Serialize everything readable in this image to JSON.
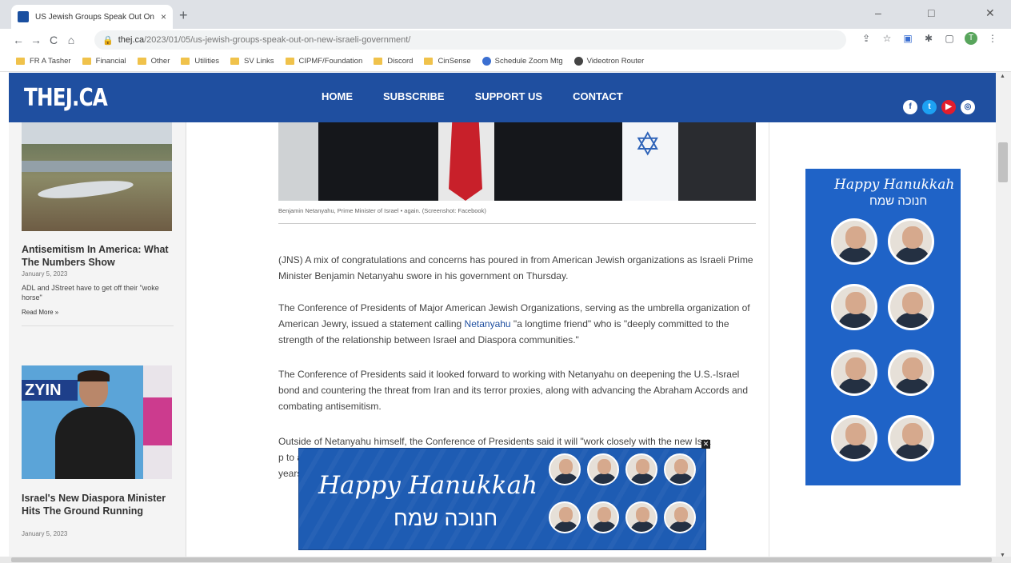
{
  "browser": {
    "tab_title": "US Jewish Groups Speak Out On",
    "tab_close": "×",
    "new_tab": "+",
    "url_host": "thej.ca",
    "url_path": "/2023/01/05/us-jewish-groups-speak-out-on-new-israeli-government/",
    "window_controls": [
      "–",
      "□",
      "✕"
    ],
    "nav": [
      "←",
      "→",
      "C",
      "⌂"
    ],
    "profile_initial": "T"
  },
  "bookmarks": [
    {
      "label": "FR A Tasher",
      "icon": "folder"
    },
    {
      "label": "Financial",
      "icon": "folder"
    },
    {
      "label": "Other",
      "icon": "folder"
    },
    {
      "label": "Utilities",
      "icon": "folder"
    },
    {
      "label": "SV Links",
      "icon": "folder"
    },
    {
      "label": "CIPMF/Foundation",
      "icon": "folder"
    },
    {
      "label": "Discord",
      "icon": "folder"
    },
    {
      "label": "CinSense",
      "icon": "folder"
    },
    {
      "label": "Schedule Zoom Mtg",
      "icon": "zoom"
    },
    {
      "label": "Videotron Router",
      "icon": "globe"
    }
  ],
  "site": {
    "logo": "THEJ.CA",
    "nav": [
      "HOME",
      "SUBSCRIBE",
      "SUPPORT US",
      "CONTACT"
    ],
    "social": [
      "f",
      "t",
      "▶",
      "◎"
    ]
  },
  "sidebar": {
    "article1_title": "Antisemitism In America: What The Numbers Show",
    "article1_date": "January 5, 2023",
    "article1_excerpt": "ADL and JStreet have to get off their \"woke horse\"",
    "read_more": "Read More »",
    "thumb2_sign": "ZYIN",
    "article2_title": "Israel's New Diaspora Minister Hits The Ground Running",
    "article2_date": "January 5, 2023"
  },
  "article": {
    "caption": "Benjamin Netanyahu, Prime Minister of Israel • again. (Screenshot: Facebook)",
    "p1": "(JNS) A mix of congratulations and concerns has poured in from American Jewish organizations as Israeli Prime Minister Benjamin Netanyahu swore in his government on Thursday.",
    "p2a": "The Conference of Presidents of Major American Jewish Organizations, serving as the umbrella organization of American Jewry, issued a statement calling ",
    "p2link": "Netanyahu",
    "p2b": " \"a longtime friend\" who is \"deeply committed to the strength of the relationship between Israel and Diaspora communities.\"",
    "p3": "The Conference of Presidents said it looked forward to working with Netanyahu on deepening the U.S.-Israel bond and countering the threat from Iran and its terror proxies, along with advancing the Abraham Accords and combating antisemitism.",
    "p4": "Outside of Netanyahu himself, the Conference of Presidents said it will \"work closely with the new Isra                                                                                     p to adv                                                                                     now- form                                                                                     years ahe"
  },
  "ads": {
    "side_title": "Happy Hanukkah",
    "side_hebrew": "חנוכה שמח",
    "bottom_title": "Happy Hanukkah",
    "bottom_hebrew": "חנוכה שמח",
    "close": "✕"
  },
  "colors": {
    "header_blue": "#1f4fa0",
    "ad_blue": "#1f63c7"
  }
}
